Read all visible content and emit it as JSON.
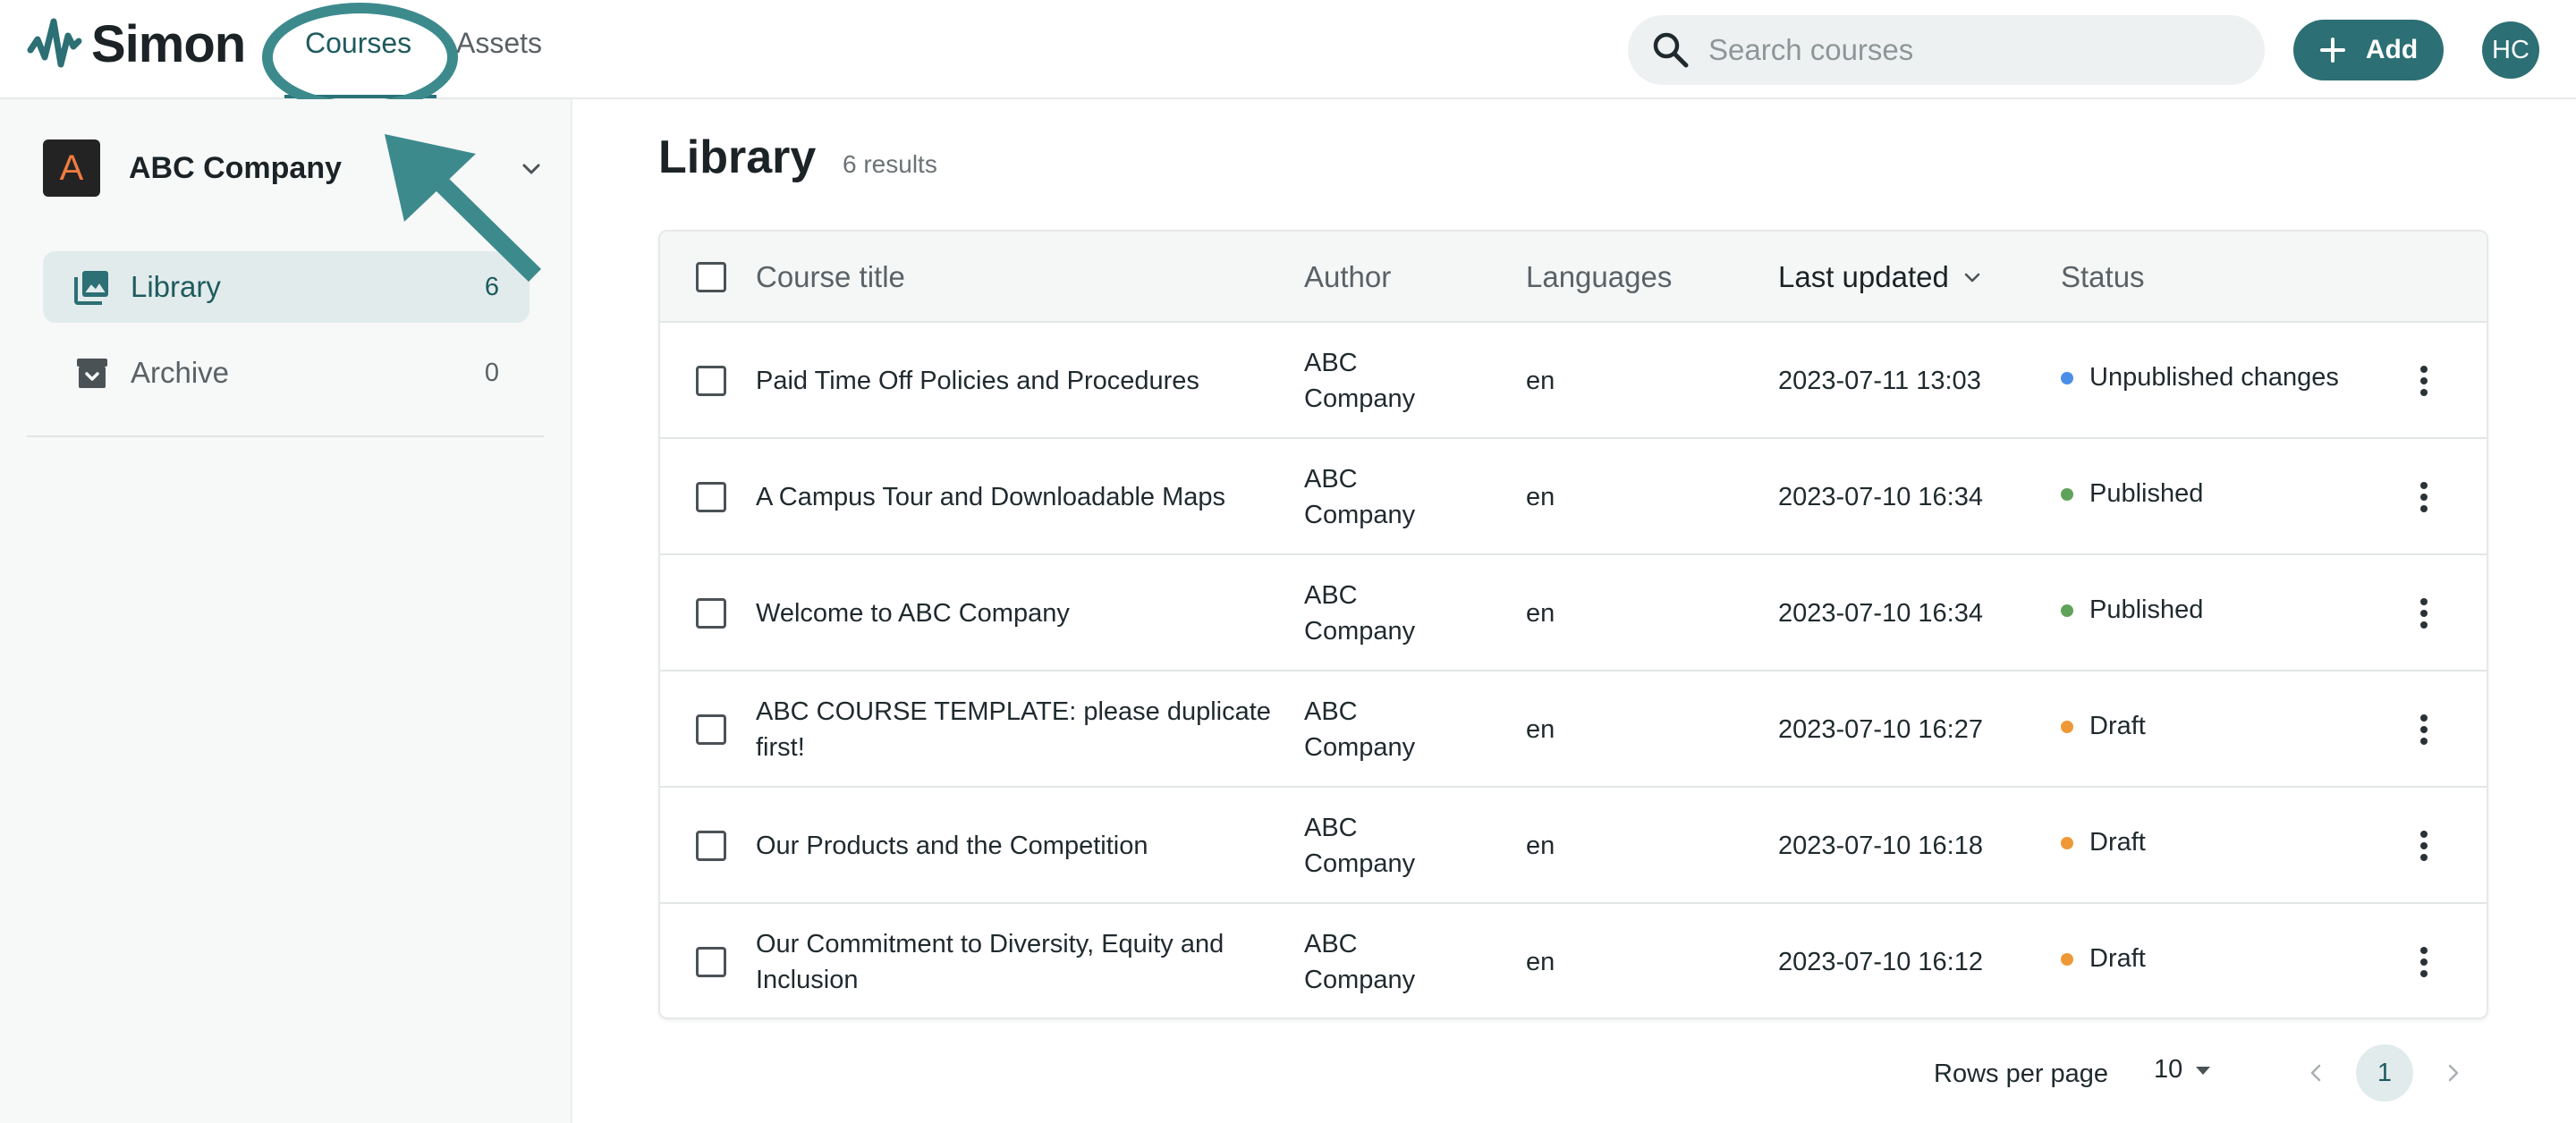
{
  "header": {
    "logo_text": "Simon",
    "nav": [
      {
        "label": "Courses",
        "active": true
      },
      {
        "label": "Assets",
        "active": false
      }
    ],
    "search_placeholder": "Search courses",
    "add_label": "Add",
    "avatar_initials": "HC",
    "accent_color": "#2c6f74"
  },
  "sidebar": {
    "org_initial": "A",
    "org_name": "ABC Company",
    "items": [
      {
        "label": "Library",
        "count": "6",
        "active": true,
        "icon": "library-icon"
      },
      {
        "label": "Archive",
        "count": "0",
        "active": false,
        "icon": "archive-icon"
      }
    ]
  },
  "main": {
    "title": "Library",
    "results": "6 results"
  },
  "table": {
    "columns": [
      "Course title",
      "Author",
      "Languages",
      "Last updated",
      "Status"
    ],
    "rows": [
      {
        "title": "Paid Time Off Policies and Procedures",
        "author": "ABC Company",
        "lang": "en",
        "updated": "2023-07-11 13:03",
        "status": "Unpublished changes",
        "status_color": "#4a8fe7"
      },
      {
        "title": "A Campus Tour and Downloadable Maps",
        "author": "ABC Company",
        "lang": "en",
        "updated": "2023-07-10 16:34",
        "status": "Published",
        "status_color": "#5fa35a"
      },
      {
        "title": "Welcome to ABC Company",
        "author": "ABC Company",
        "lang": "en",
        "updated": "2023-07-10 16:34",
        "status": "Published",
        "status_color": "#5fa35a"
      },
      {
        "title": "ABC COURSE TEMPLATE: please duplicate first!",
        "author": "ABC Company",
        "lang": "en",
        "updated": "2023-07-10 16:27",
        "status": "Draft",
        "status_color": "#ee9838"
      },
      {
        "title": "Our Products and the Competition",
        "author": "ABC Company",
        "lang": "en",
        "updated": "2023-07-10 16:18",
        "status": "Draft",
        "status_color": "#ee9838"
      },
      {
        "title": "Our Commitment to Diversity, Equity and Inclusion",
        "author": "ABC Company",
        "lang": "en",
        "updated": "2023-07-10 16:12",
        "status": "Draft",
        "status_color": "#ee9838"
      }
    ]
  },
  "pagination": {
    "rows_per_page_label": "Rows per page",
    "rows_per_page": "10",
    "current_page": "1"
  }
}
